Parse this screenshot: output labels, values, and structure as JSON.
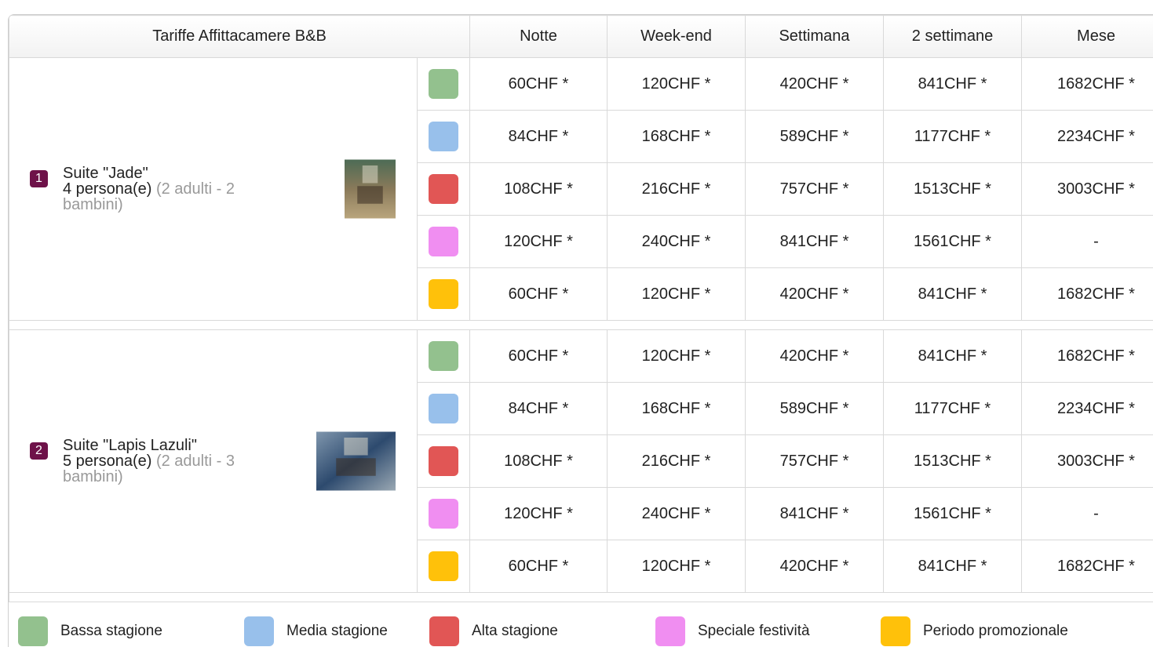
{
  "table": {
    "title": "Tariffe Affittacamere B&B",
    "columns": [
      "Notte",
      "Week-end",
      "Settimana",
      "2 settimane",
      "Mese"
    ]
  },
  "seasons": [
    {
      "name": "Bassa stagione",
      "color": "#93c18e"
    },
    {
      "name": "Media stagione",
      "color": "#98c0eb"
    },
    {
      "name": "Alta stagione",
      "color": "#e15655"
    },
    {
      "name": "Speciale festività",
      "color": "#f08ef1"
    },
    {
      "name": "Periodo promozionale",
      "color": "#ffc10a"
    }
  ],
  "rooms": [
    {
      "number": "1",
      "name": "Suite \"Jade\"",
      "capacity": "4 persona(e)",
      "details": "(2 adulti - 2 bambini)",
      "rates": [
        [
          "60CHF *",
          "120CHF *",
          "420CHF *",
          "841CHF *",
          "1682CHF *"
        ],
        [
          "84CHF *",
          "168CHF *",
          "589CHF *",
          "1177CHF *",
          "2234CHF *"
        ],
        [
          "108CHF *",
          "216CHF *",
          "757CHF *",
          "1513CHF *",
          "3003CHF *"
        ],
        [
          "120CHF *",
          "240CHF *",
          "841CHF *",
          "1561CHF *",
          "-"
        ],
        [
          "60CHF *",
          "120CHF *",
          "420CHF *",
          "841CHF *",
          "1682CHF *"
        ]
      ]
    },
    {
      "number": "2",
      "name": "Suite \"Lapis Lazuli\"",
      "capacity": "5 persona(e)",
      "details": "(2 adulti - 3 bambini)",
      "rates": [
        [
          "60CHF *",
          "120CHF *",
          "420CHF *",
          "841CHF *",
          "1682CHF *"
        ],
        [
          "84CHF *",
          "168CHF *",
          "589CHF *",
          "1177CHF *",
          "2234CHF *"
        ],
        [
          "108CHF *",
          "216CHF *",
          "757CHF *",
          "1513CHF *",
          "3003CHF *"
        ],
        [
          "120CHF *",
          "240CHF *",
          "841CHF *",
          "1561CHF *",
          "-"
        ],
        [
          "60CHF *",
          "120CHF *",
          "420CHF *",
          "841CHF *",
          "1682CHF *"
        ]
      ]
    }
  ]
}
